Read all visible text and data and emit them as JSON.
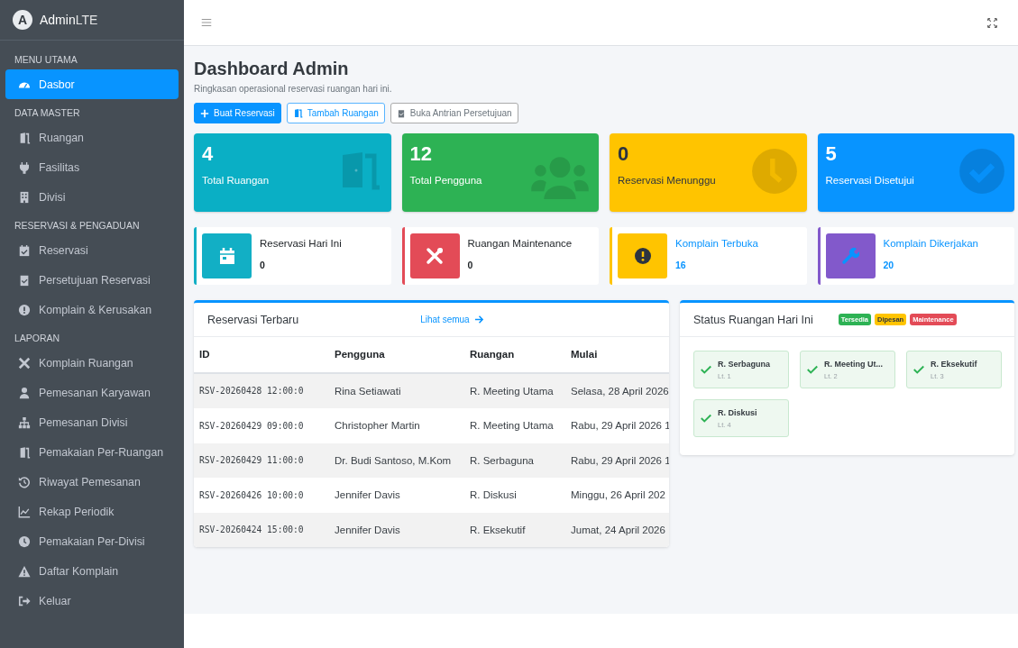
{
  "brand": {
    "logo": "A",
    "name_bold": "Admin",
    "name_light": "LTE"
  },
  "sidebar": {
    "sections": [
      {
        "header": "MENU UTAMA",
        "items": [
          {
            "label": "Dasbor",
            "selected": true
          }
        ]
      },
      {
        "header": "DATA MASTER",
        "items": [
          {
            "label": "Ruangan",
            "selected": false
          },
          {
            "label": "Fasilitas",
            "selected": false
          },
          {
            "label": "Divisi",
            "selected": false
          }
        ]
      },
      {
        "header": "RESERVASI & PENGADUAN",
        "items": [
          {
            "label": "Reservasi",
            "selected": false
          },
          {
            "label": "Persetujuan Reservasi",
            "selected": false
          },
          {
            "label": "Komplain & Kerusakan",
            "selected": false
          }
        ]
      },
      {
        "header": "LAPORAN",
        "items": [
          {
            "label": "Komplain Ruangan",
            "selected": false
          },
          {
            "label": "Pemesanan Karyawan",
            "selected": false
          },
          {
            "label": "Pemesanan Divisi",
            "selected": false
          },
          {
            "label": "Pemakaian Per-Ruangan",
            "selected": false
          },
          {
            "label": "Riwayat Pemesanan",
            "selected": false
          },
          {
            "label": "Rekap Periodik",
            "selected": false
          },
          {
            "label": "Pemakaian Per-Divisi",
            "selected": false
          },
          {
            "label": "Daftar Komplain",
            "selected": false
          },
          {
            "label": "Keluar",
            "selected": false
          }
        ]
      }
    ]
  },
  "page": {
    "title": "Dashboard Admin",
    "subtitle": "Ringkasan operasional reservasi ruangan hari ini."
  },
  "actions": [
    {
      "label": "Buat Reservasi",
      "kind": "primary"
    },
    {
      "label": "Tambah Ruangan",
      "kind": "outline-primary"
    },
    {
      "label": "Buka Antrian Persetujuan",
      "kind": "outline-secondary"
    }
  ],
  "stat_boxes": [
    {
      "value": "4",
      "label": "Total Ruangan",
      "color": "#0aafc5"
    },
    {
      "value": "12",
      "label": "Total Pengguna",
      "color": "#2db254"
    },
    {
      "value": "0",
      "label": "Reservasi Menunggu",
      "color": "#ffc400"
    },
    {
      "value": "5",
      "label": "Reservasi Disetujui",
      "color": "#0894ff"
    }
  ],
  "info_boxes": [
    {
      "label": "Reservasi Hari Ini",
      "value": "0",
      "color": "#12afc5",
      "link": false
    },
    {
      "label": "Ruangan Maintenance",
      "value": "0",
      "color": "#e34b57",
      "link": false
    },
    {
      "label": "Komplain Terbuka",
      "value": "16",
      "color": "#ffc400",
      "link": true
    },
    {
      "label": "Komplain Dikerjakan",
      "value": "20",
      "color": "#8259cb",
      "link": true
    }
  ],
  "recent": {
    "title": "Reservasi Terbaru",
    "link": "Lihat semua",
    "columns": [
      "ID",
      "Pengguna",
      "Ruangan",
      "Mulai"
    ],
    "rows": [
      [
        "RSV-20260428 12:00:0",
        "Rina Setiawati",
        "R. Meeting Utama",
        "Selasa, 28 April 2026"
      ],
      [
        "RSV-20260429 09:00:0",
        "Christopher Martin",
        "R. Meeting Utama",
        "Rabu, 29 April 2026 1"
      ],
      [
        "RSV-20260429 11:00:0",
        "Dr. Budi Santoso, M.Kom",
        "R. Serbaguna",
        "Rabu, 29 April 2026 1"
      ],
      [
        "RSV-20260426 10:00:0",
        "Jennifer Davis",
        "R. Diskusi",
        "Minggu, 26 April 202"
      ],
      [
        "RSV-20260424 15:00:0",
        "Jennifer Davis",
        "R. Eksekutif",
        "Jumat, 24 April 2026"
      ]
    ]
  },
  "room_status": {
    "title": "Status Ruangan Hari Ini",
    "legend": [
      {
        "label": "Tersedia",
        "color": "#2db254"
      },
      {
        "label": "Dipesan",
        "color": "#ffc400"
      },
      {
        "label": "Maintenance",
        "color": "#e34b57"
      }
    ],
    "rooms": [
      {
        "name": "R. Serbaguna",
        "floor": "Lt. 1",
        "kind": "available"
      },
      {
        "name": "R. Meeting Ut...",
        "floor": "Lt. 2",
        "kind": "available"
      },
      {
        "name": "R. Eksekutif",
        "floor": "Lt. 3",
        "kind": "available"
      },
      {
        "name": "R. Diskusi",
        "floor": "Lt. 4",
        "kind": "available"
      }
    ]
  }
}
